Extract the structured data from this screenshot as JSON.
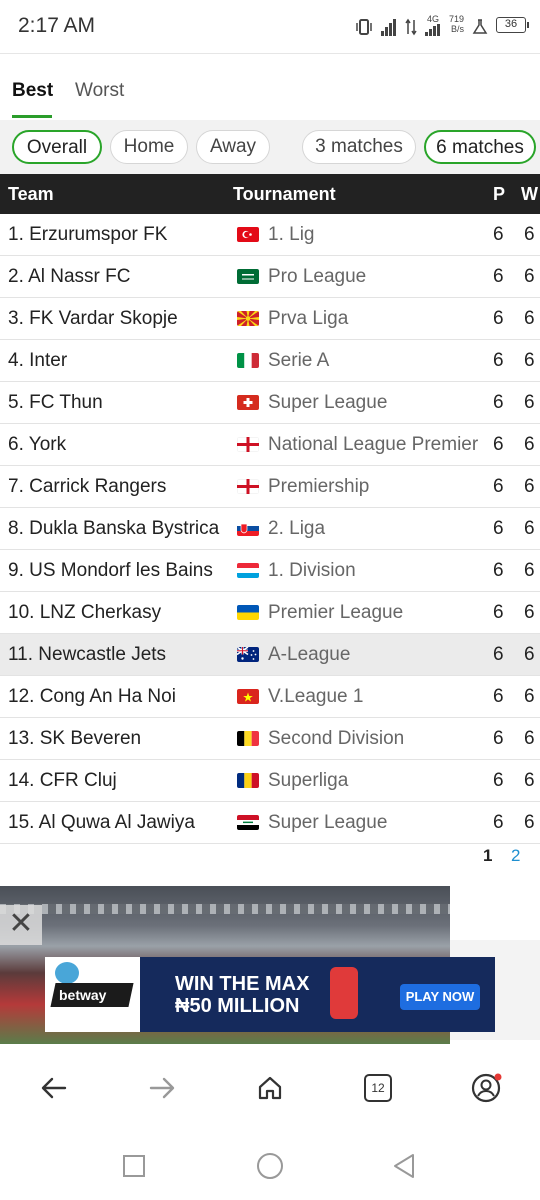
{
  "status_bar": {
    "time": "2:17 AM",
    "network": "4G",
    "speed_value": "719",
    "speed_unit": "B/s",
    "battery": "36"
  },
  "tabs": [
    {
      "label": "Best",
      "active": true
    },
    {
      "label": "Worst",
      "active": false
    }
  ],
  "filters": [
    {
      "label": "Overall",
      "selected": true
    },
    {
      "label": "Home",
      "selected": false
    },
    {
      "label": "Away",
      "selected": false
    },
    {
      "label": "3 matches",
      "selected": false
    },
    {
      "label": "6 matches",
      "selected": true
    }
  ],
  "table": {
    "headers": {
      "team": "Team",
      "tournament": "Tournament",
      "p": "P",
      "w": "W"
    },
    "rows": [
      {
        "team": "1. Erzurumspor FK",
        "flag": "turkey",
        "tournament": "1. Lig",
        "p": "6",
        "w": "6"
      },
      {
        "team": "2. Al Nassr FC",
        "flag": "saudi-arabia",
        "tournament": "Pro League",
        "p": "6",
        "w": "6"
      },
      {
        "team": "3. FK Vardar Skopje",
        "flag": "north-macedonia",
        "tournament": "Prva Liga",
        "p": "6",
        "w": "6"
      },
      {
        "team": "4. Inter",
        "flag": "italy",
        "tournament": "Serie A",
        "p": "6",
        "w": "6"
      },
      {
        "team": "5. FC Thun",
        "flag": "switzerland",
        "tournament": "Super League",
        "p": "6",
        "w": "6"
      },
      {
        "team": "6. York",
        "flag": "england",
        "tournament": "National League Premier",
        "p": "6",
        "w": "6"
      },
      {
        "team": "7. Carrick Rangers",
        "flag": "northern-ireland",
        "tournament": "Premiership",
        "p": "6",
        "w": "6"
      },
      {
        "team": "8. Dukla Banska Bystrica",
        "flag": "slovakia",
        "tournament": "2. Liga",
        "p": "6",
        "w": "6"
      },
      {
        "team": "9. US Mondorf les Bains",
        "flag": "luxembourg",
        "tournament": "1. Division",
        "p": "6",
        "w": "6"
      },
      {
        "team": "10. LNZ Cherkasy",
        "flag": "ukraine",
        "tournament": "Premier League",
        "p": "6",
        "w": "6"
      },
      {
        "team": "11. Newcastle Jets",
        "flag": "australia",
        "tournament": "A-League",
        "p": "6",
        "w": "6",
        "highlighted": true
      },
      {
        "team": "12. Cong An Ha Noi",
        "flag": "vietnam",
        "tournament": "V.League 1",
        "p": "6",
        "w": "6"
      },
      {
        "team": "13. SK Beveren",
        "flag": "belgium",
        "tournament": "Second Division",
        "p": "6",
        "w": "6"
      },
      {
        "team": "14. CFR Cluj",
        "flag": "romania",
        "tournament": "Superliga",
        "p": "6",
        "w": "6"
      },
      {
        "team": "15. Al Quwa Al Jawiya",
        "flag": "iraq",
        "tournament": "Super League",
        "p": "6",
        "w": "6"
      }
    ]
  },
  "pagination": {
    "current": "1",
    "next": "2"
  },
  "ad": {
    "brand": "betway",
    "line1": "WIN THE MAX",
    "line2": "₦50 MILLION",
    "cta": "PLAY NOW",
    "close_glyph": "✕"
  },
  "browser_nav": {
    "tab_count": "12"
  },
  "colors": {
    "accent_green": "#2aa52a",
    "header_bg": "#222222",
    "link_blue": "#1e8fd0",
    "ad_bg": "#152a5c"
  }
}
